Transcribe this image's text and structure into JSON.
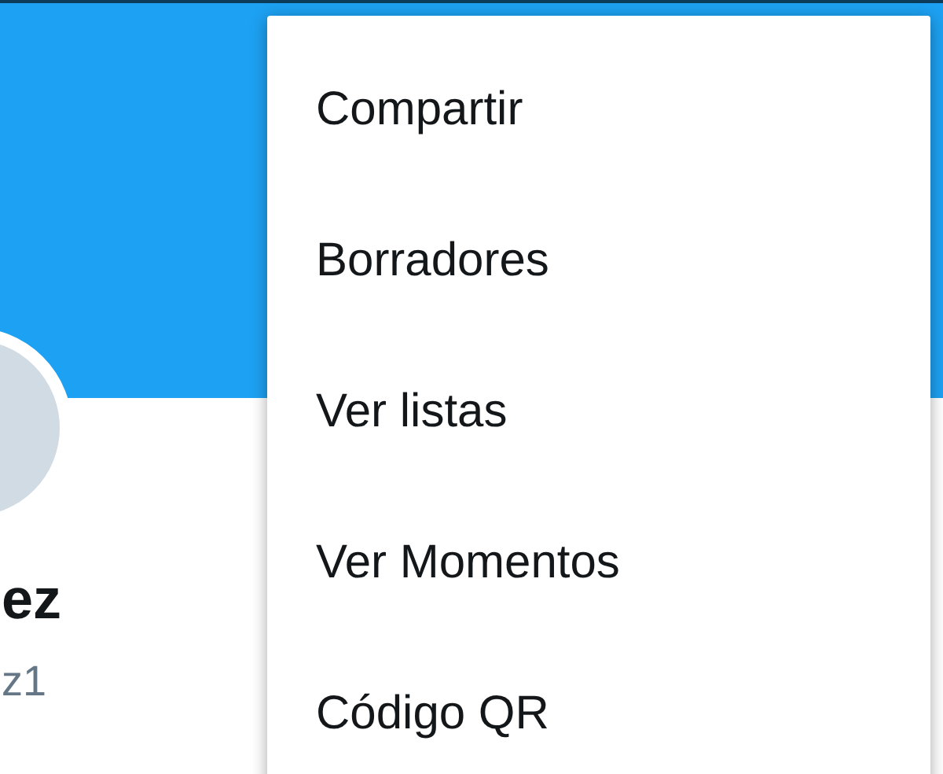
{
  "profile": {
    "name": "ez",
    "handle": "z1"
  },
  "menu": {
    "items": [
      {
        "label": "Compartir"
      },
      {
        "label": "Borradores"
      },
      {
        "label": "Ver listas"
      },
      {
        "label": "Ver Momentos"
      },
      {
        "label": "Código QR"
      }
    ]
  }
}
